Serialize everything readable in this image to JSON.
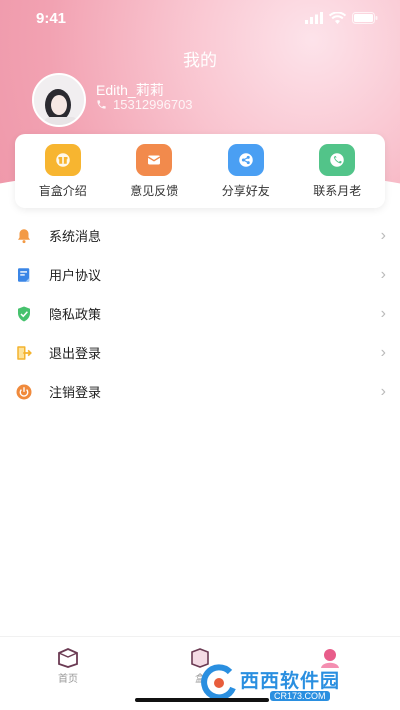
{
  "status_bar": {
    "time": "9:41"
  },
  "header": {
    "title": "我的"
  },
  "user": {
    "name": "Edith_莉莉",
    "phone": "15312996703"
  },
  "shortcuts": [
    {
      "label": "盲盒介绍",
      "icon": "gift-box-icon",
      "color": "#f7b530"
    },
    {
      "label": "意见反馈",
      "icon": "feedback-mail-icon",
      "color": "#f28a4c"
    },
    {
      "label": "分享好友",
      "icon": "share-icon",
      "color": "#4a9ff3"
    },
    {
      "label": "联系月老",
      "icon": "phone-icon",
      "color": "#52c489"
    }
  ],
  "menu": [
    {
      "label": "系统消息",
      "icon": "bell-icon",
      "color": "#f39a45"
    },
    {
      "label": "用户协议",
      "icon": "document-icon",
      "color": "#3b86e6"
    },
    {
      "label": "隐私政策",
      "icon": "shield-check-icon",
      "color": "#47c26e"
    },
    {
      "label": "退出登录",
      "icon": "logout-icon",
      "color": "#f4b32e"
    },
    {
      "label": "注销登录",
      "icon": "power-icon",
      "color": "#f08a3c"
    }
  ],
  "tabbar": {
    "tabs": [
      {
        "label": "首页"
      },
      {
        "label": "盒"
      },
      {
        "label": ""
      }
    ],
    "accent": "#e85d8a"
  },
  "watermark": {
    "main": "西西软件园",
    "url": "CR173.COM"
  }
}
